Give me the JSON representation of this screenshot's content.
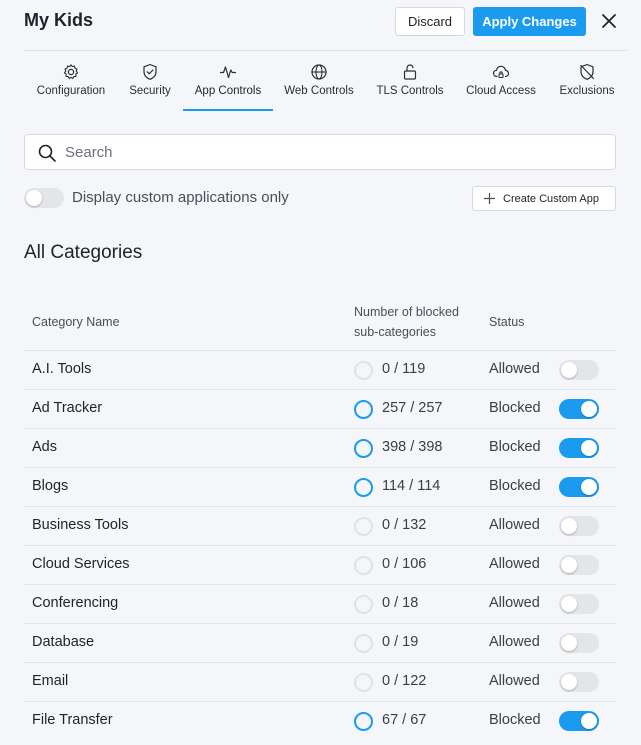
{
  "header": {
    "title": "My Kids",
    "discard_label": "Discard",
    "apply_label": "Apply Changes"
  },
  "tabs": [
    {
      "label": "Configuration",
      "icon": "gear-icon"
    },
    {
      "label": "Security",
      "icon": "shield-check-icon"
    },
    {
      "label": "App Controls",
      "icon": "activity-icon",
      "active": true
    },
    {
      "label": "Web Controls",
      "icon": "globe-icon"
    },
    {
      "label": "TLS Controls",
      "icon": "unlock-icon"
    },
    {
      "label": "Cloud Access",
      "icon": "cloud-lock-icon"
    },
    {
      "label": "Exclusions",
      "icon": "shield-off-icon"
    }
  ],
  "search": {
    "placeholder": "Search",
    "value": ""
  },
  "custom_filter": {
    "label": "Display custom applications only",
    "enabled": false
  },
  "create_button": {
    "label": "Create Custom App"
  },
  "section_title": "All Categories",
  "table": {
    "headers": {
      "name": "Category Name",
      "count": "Number of blocked sub-categories",
      "status": "Status"
    },
    "rows": [
      {
        "name": "A.I. Tools",
        "count": "0 / 119",
        "status": "Allowed"
      },
      {
        "name": "Ad Tracker",
        "count": "257 / 257",
        "status": "Blocked"
      },
      {
        "name": "Ads",
        "count": "398 / 398",
        "status": "Blocked"
      },
      {
        "name": "Blogs",
        "count": "114 / 114",
        "status": "Blocked"
      },
      {
        "name": "Business Tools",
        "count": "0 / 132",
        "status": "Allowed"
      },
      {
        "name": "Cloud Services",
        "count": "0 / 106",
        "status": "Allowed"
      },
      {
        "name": "Conferencing",
        "count": "0 / 18",
        "status": "Allowed"
      },
      {
        "name": "Database",
        "count": "0 / 19",
        "status": "Allowed"
      },
      {
        "name": "Email",
        "count": "0 / 122",
        "status": "Allowed"
      },
      {
        "name": "File Transfer",
        "count": "67 / 67",
        "status": "Blocked"
      }
    ]
  },
  "colors": {
    "accent": "#1a9bf0",
    "background": "#f4f6f9",
    "toggle_off": "#e3e5e8"
  }
}
